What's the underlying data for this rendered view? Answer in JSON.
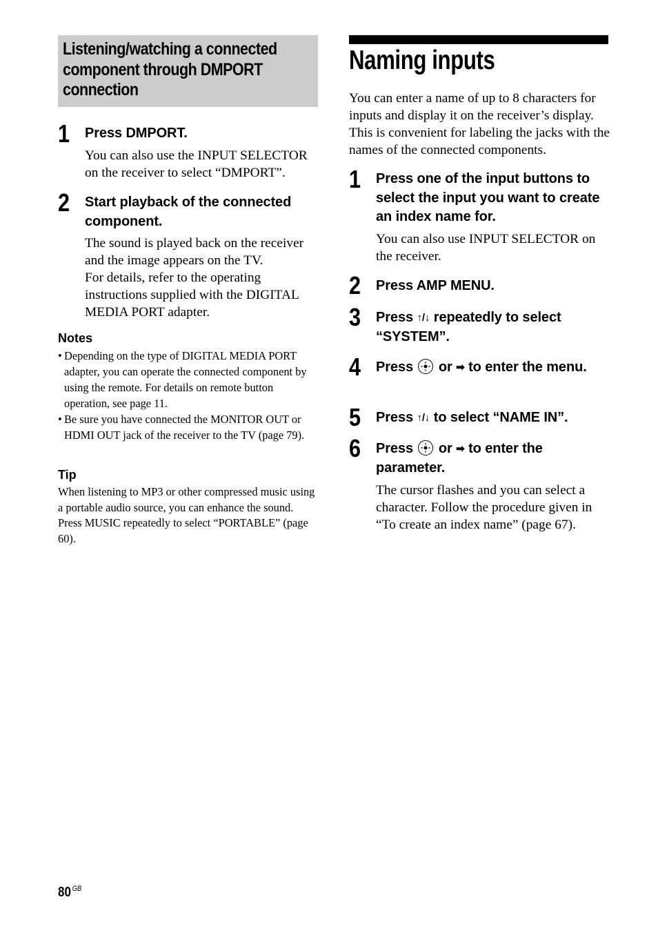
{
  "left_section": {
    "heading": "Listening/watching a connected component through DMPORT connection",
    "steps": [
      {
        "number": "1",
        "title": "Press DMPORT.",
        "body": "You can also use the INPUT SELECTOR on the receiver to select “DMPORT”."
      },
      {
        "number": "2",
        "title": "Start playback of the connected component.",
        "body": "The sound is played back on the receiver and the image appears on the TV.\nFor details, refer to the operating instructions supplied with the DIGITAL MEDIA PORT adapter."
      }
    ],
    "notes": {
      "heading": "Notes",
      "items": [
        "Depending on the type of DIGITAL MEDIA PORT adapter, you can operate the connected component by using the remote. For details on remote button operation, see page 11.",
        "Be sure you have connected the MONITOR OUT or HDMI OUT jack of the receiver to the TV (page 79)."
      ]
    },
    "tip": {
      "heading": "Tip",
      "text": "When listening to MP3 or other compressed music using a portable audio source, you can enhance the sound. Press MUSIC repeatedly to select “PORTABLE” (page 60)."
    }
  },
  "right_section": {
    "title": "Naming inputs",
    "intro": "You can enter a name of up to 8 characters for inputs and display it on the receiver’s display. This is convenient for labeling the jacks with the names of the connected components.",
    "steps": [
      {
        "number": "1",
        "title": "Press one of the input buttons to select the input you want to create an index name for.",
        "body": "You can also use INPUT SELECTOR on the receiver."
      },
      {
        "number": "2",
        "title": "Press AMP MENU."
      },
      {
        "number": "3",
        "title_pre": "Press ",
        "title_arrows": "↑/↓",
        "title_post": " repeatedly to select “SYSTEM”."
      },
      {
        "number": "4",
        "title_pre": "Press ",
        "title_mid": " or ",
        "title_arrow": "➡",
        "title_post": " to enter the menu."
      },
      {
        "number": "5",
        "title_pre": "Press ",
        "title_arrows": "↑/↓",
        "title_post": " to select “NAME IN”."
      },
      {
        "number": "6",
        "title_pre": "Press ",
        "title_mid": " or ",
        "title_arrow": "➡",
        "title_post": " to enter the parameter.",
        "body": "The cursor flashes and you can select a character. Follow the procedure given in “To create an index name” (page 67)."
      }
    ]
  },
  "footer": {
    "page_number": "80",
    "region_code": "GB"
  }
}
